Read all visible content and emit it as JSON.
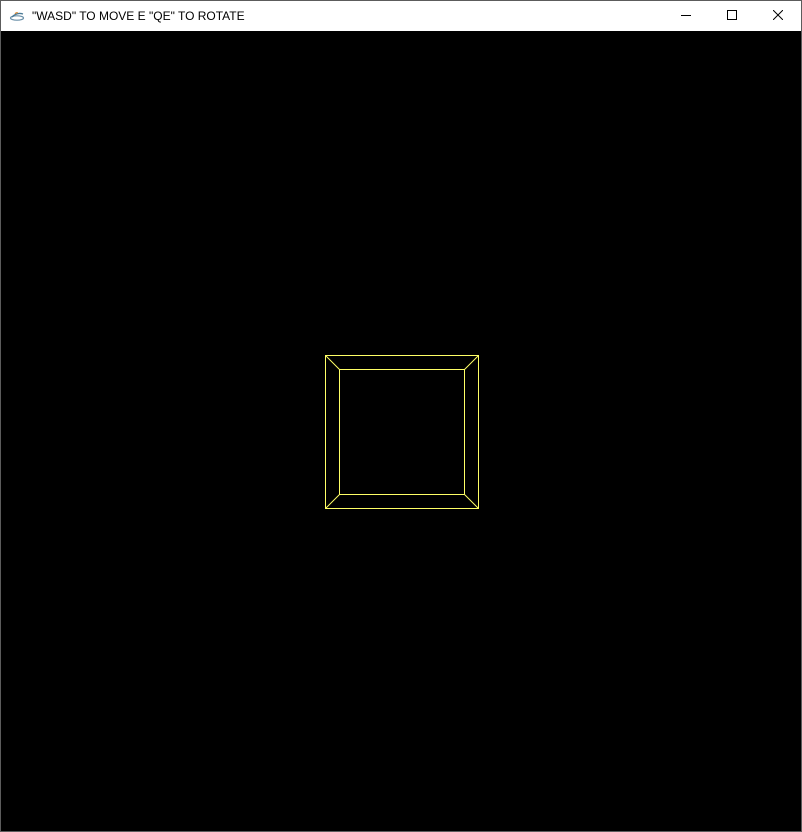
{
  "window": {
    "title": "\"WASD\" TO MOVE E \"QE\" TO ROTATE",
    "app_icon": "java-cup-icon",
    "controls": {
      "minimize_icon": "minimize-icon",
      "maximize_icon": "maximize-icon",
      "close_icon": "close-icon"
    }
  },
  "scene": {
    "background_color": "#000000",
    "wireframe_color": "#ffff66",
    "object": "wireframe-cube"
  }
}
